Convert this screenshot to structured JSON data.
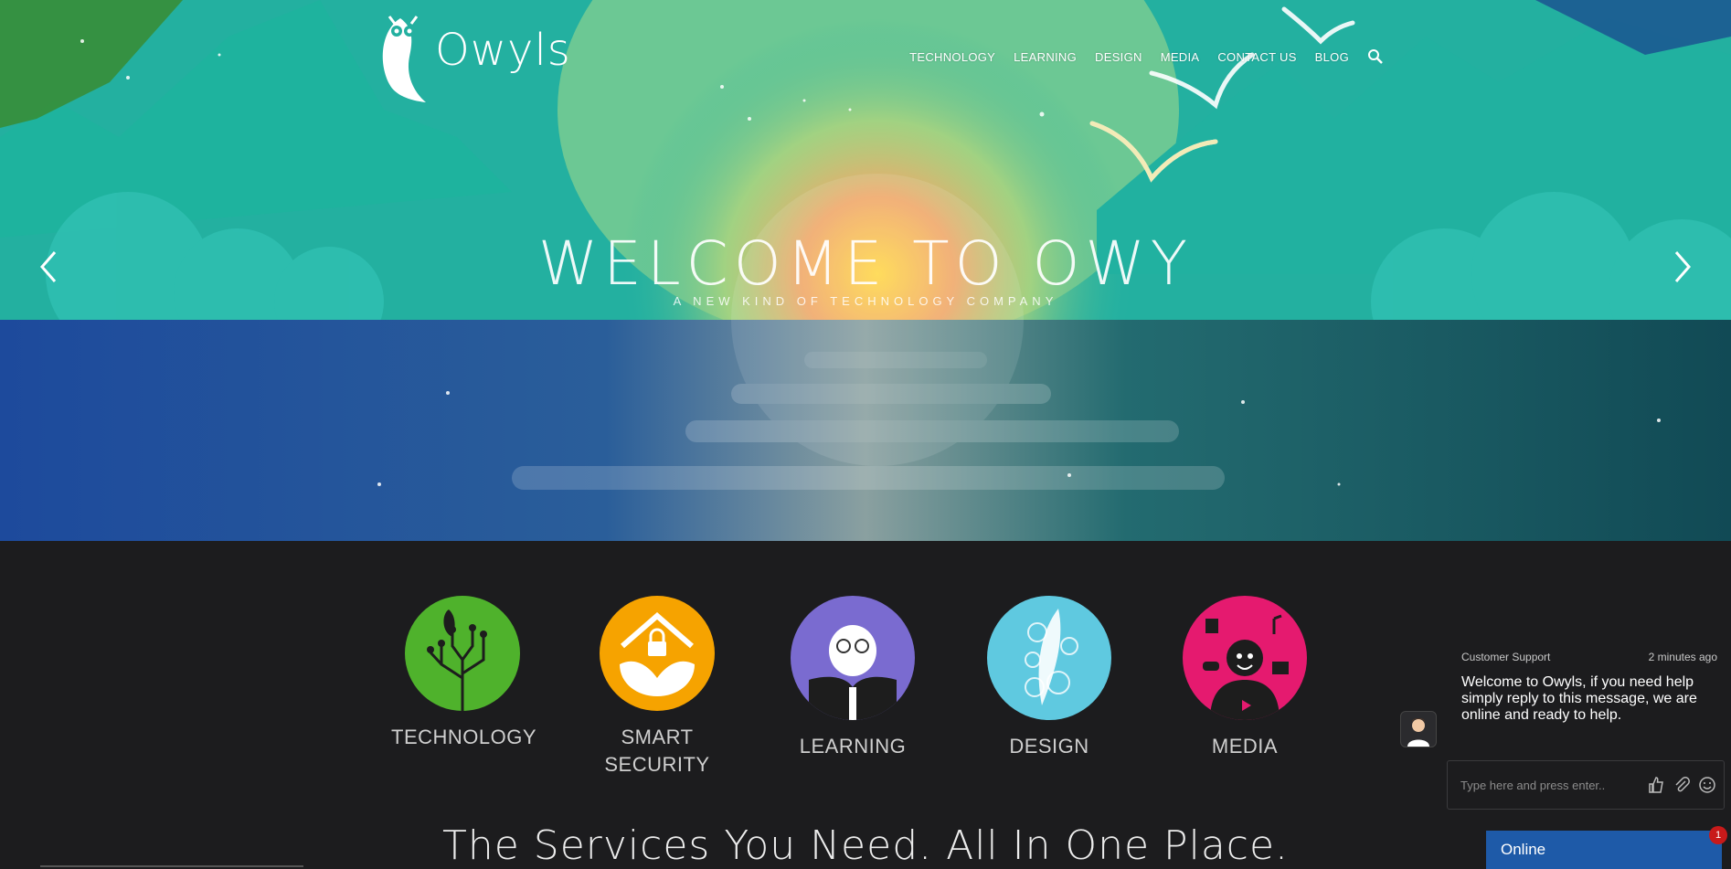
{
  "brand": {
    "name": "Owyls"
  },
  "nav": {
    "items": [
      "TECHNOLOGY",
      "LEARNING",
      "DESIGN",
      "MEDIA",
      "CONTACT US",
      "BLOG"
    ]
  },
  "hero": {
    "title": "WELCOME TO OWY",
    "subtitle": "A NEW KIND OF TECHNOLOGY COMPANY"
  },
  "services": [
    {
      "label": "TECHNOLOGY",
      "color": "#4fb22c",
      "icon": "tree-circuit-icon"
    },
    {
      "label": "SMART SECURITY",
      "color": "#f6a300",
      "icon": "house-lock-icon"
    },
    {
      "label": "LEARNING",
      "color": "#7a6bd0",
      "icon": "owl-book-icon"
    },
    {
      "label": "DESIGN",
      "color": "#5fc9e0",
      "icon": "feather-bubbles-icon"
    },
    {
      "label": "MEDIA",
      "color": "#e51a6f",
      "icon": "media-person-icon"
    }
  ],
  "tagline": "The Services You Need. All In One Place.",
  "chat": {
    "agent": "Customer Support",
    "time": "2 minutes ago",
    "message": "Welcome to Owyls, if you need help simply reply to this message, we are online and ready to help.",
    "input_placeholder": "Type here and press enter..",
    "status": "Online",
    "unread": "1"
  }
}
